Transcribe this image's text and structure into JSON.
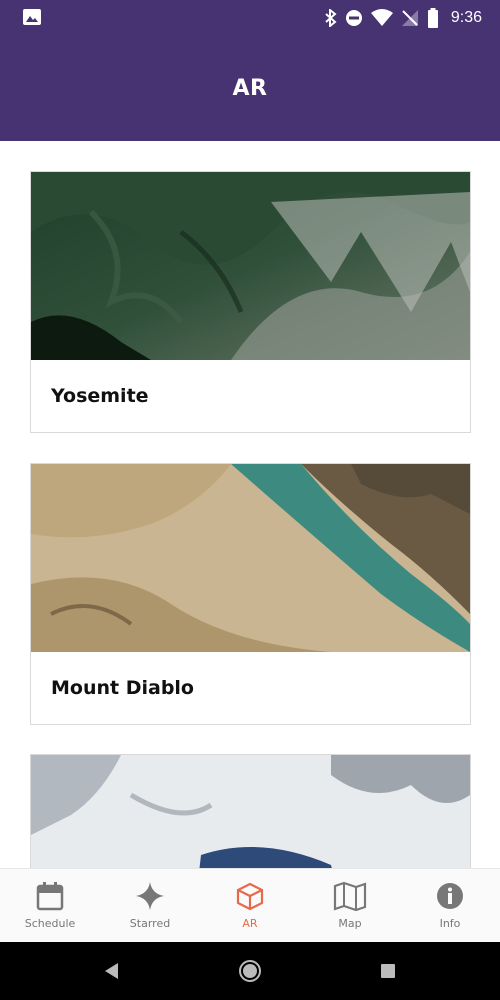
{
  "status_bar": {
    "time": "9:36",
    "icons": [
      "image-icon",
      "bluetooth-icon",
      "do-not-disturb-icon",
      "wifi-icon",
      "no-signal-icon",
      "battery-icon"
    ]
  },
  "app_bar": {
    "title": "AR"
  },
  "cards": [
    {
      "title": "Yosemite"
    },
    {
      "title": "Mount Diablo"
    },
    {
      "title": ""
    }
  ],
  "bottom_nav": {
    "items": [
      {
        "label": "Schedule",
        "icon": "calendar-icon"
      },
      {
        "label": "Starred",
        "icon": "star-icon"
      },
      {
        "label": "AR",
        "icon": "ar-cube-icon",
        "active": true
      },
      {
        "label": "Map",
        "icon": "map-icon"
      },
      {
        "label": "Info",
        "icon": "info-icon"
      }
    ]
  },
  "colors": {
    "primary": "#473272",
    "accent": "#e8694a",
    "nav_inactive": "#777777"
  }
}
